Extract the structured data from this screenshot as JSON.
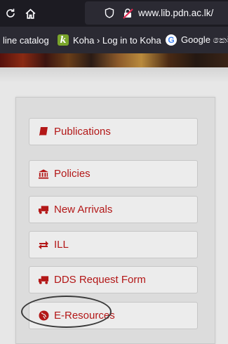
{
  "browser": {
    "url": "www.lib.pdn.ac.lk/",
    "bookmarks": [
      {
        "label": "line catalog"
      },
      {
        "label": "Koha › Log in to Koha",
        "icon": "koha-icon",
        "favicon_letter": "k"
      },
      {
        "label": "Google කෙටි",
        "icon": "google-icon",
        "favicon_letter": "G"
      }
    ]
  },
  "nav": {
    "items": [
      {
        "label": "Publications",
        "icon": "book-icon"
      },
      {
        "label": "Policies",
        "icon": "institution-icon"
      },
      {
        "label": "New Arrivals",
        "icon": "truck-icon"
      },
      {
        "label": "ILL",
        "icon": "exchange-icon"
      },
      {
        "label": "DDS Request Form",
        "icon": "truck-icon"
      },
      {
        "label": "E-Resources",
        "icon": "globe-icon"
      }
    ]
  },
  "colors": {
    "link_red": "#b31717",
    "koha_green": "#7aa52b"
  }
}
